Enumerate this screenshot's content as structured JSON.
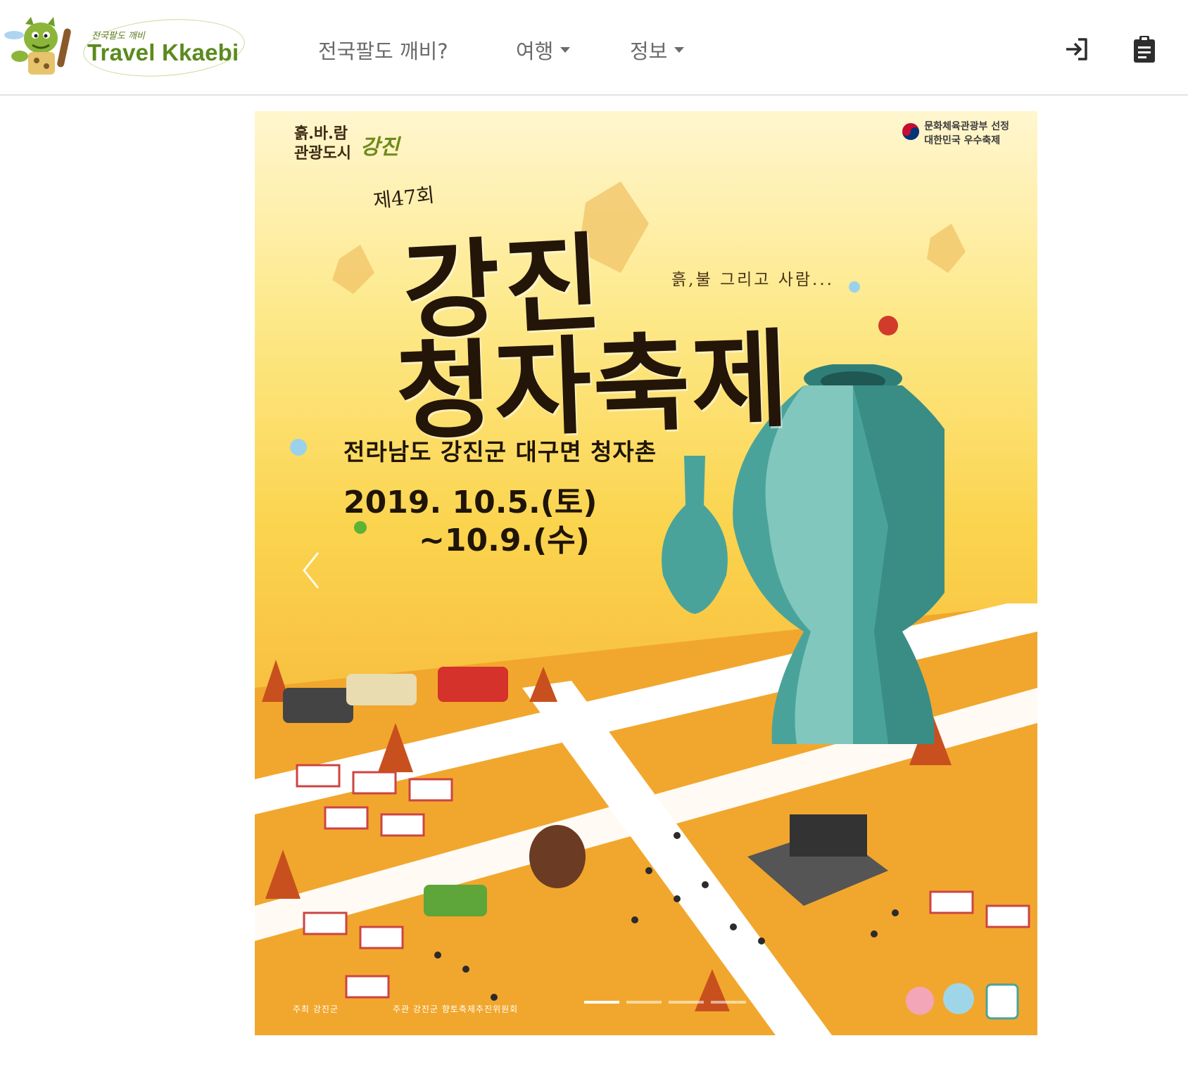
{
  "header": {
    "logo": {
      "subtitle": "전국팔도 깨비",
      "title": "Travel Kkaebi"
    },
    "nav": [
      {
        "label": "전국팔도 깨비?",
        "dropdown": false
      },
      {
        "label": "여행",
        "dropdown": true
      },
      {
        "label": "정보",
        "dropdown": true
      }
    ],
    "icons": {
      "login": "login-icon",
      "board": "clipboard-icon"
    }
  },
  "carousel": {
    "slide_count": 4,
    "active_index": 0,
    "poster": {
      "city_line1": "흙.바.람",
      "city_line2": "관광도시",
      "city_name": "강진",
      "gov_line1": "문화체육관광부 선정",
      "gov_line2": "대한민국 우수축제",
      "edition": "제47회",
      "title_line1": "강진",
      "title_line2": "청자축제",
      "slogan": "흙,불 그리고 사람...",
      "place": "전라남도 강진군 대구면 청자촌",
      "date_start": "2019. 10.5.(토)",
      "date_end": "~10.9.(수)",
      "host": "주최  강진군",
      "organizer": "주관  강진군 향토축제추진위원회"
    },
    "colors": {
      "celadon": "#4aa39a",
      "poster_yellow": "#fbd44e",
      "ground": "#f2a82e"
    }
  }
}
